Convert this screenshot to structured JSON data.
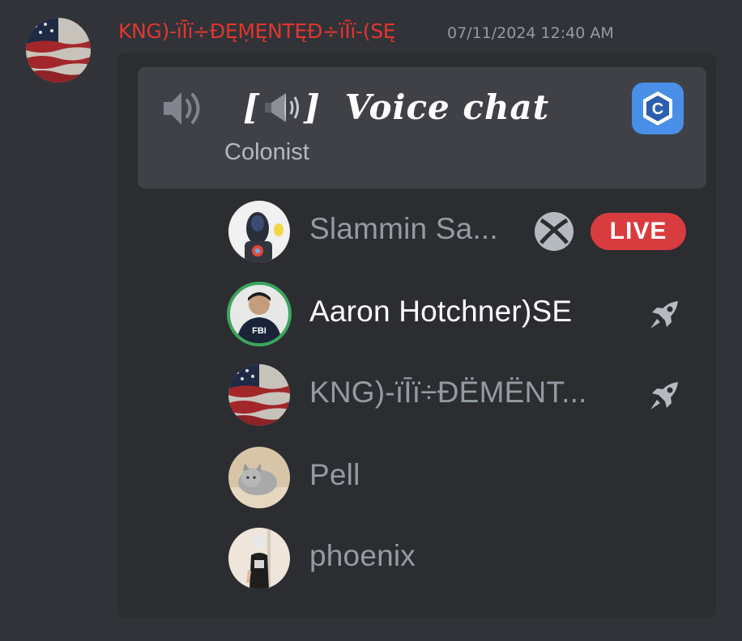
{
  "message": {
    "author_name": "KNG)-ïĪï÷ĐĘṂĘNTĘĐ÷ïĪï-(SĘ",
    "timestamp": "07/11/2024 12:40 AM",
    "author_avatar": "american-flag-avatar"
  },
  "voice_embed": {
    "channel_name": "Voice chat",
    "channel_prefix_open": "[",
    "channel_prefix_close": "]",
    "server_name": "Colonist",
    "server_icon_letter": "C",
    "speaker_icon": "speaker-icon",
    "participants": [
      {
        "name": "Slammin Sa...",
        "status_icon": "xbox-icon",
        "badge": "LIVE",
        "avatar": "robot-avatar",
        "speaking": false
      },
      {
        "name": "Aaron Hotchner)SE",
        "status_icon": "rocket-icon",
        "avatar": "fbi-avatar",
        "speaking": true
      },
      {
        "name": "KNG)-ïĪï÷ĐËMËNT...",
        "status_icon": "rocket-icon",
        "avatar": "american-flag-avatar",
        "speaking": false
      },
      {
        "name": "Pell",
        "avatar": "cat-avatar",
        "speaking": false
      },
      {
        "name": "phoenix",
        "avatar": "person-avatar",
        "speaking": false
      }
    ]
  },
  "colors": {
    "background": "#313338",
    "card": "#2b2d31",
    "header": "#3f4147",
    "author_name": "#e0362f",
    "live_badge": "#d83c3e",
    "speaking_ring": "#3ba55c",
    "server_icon": "#4a8fe7"
  }
}
